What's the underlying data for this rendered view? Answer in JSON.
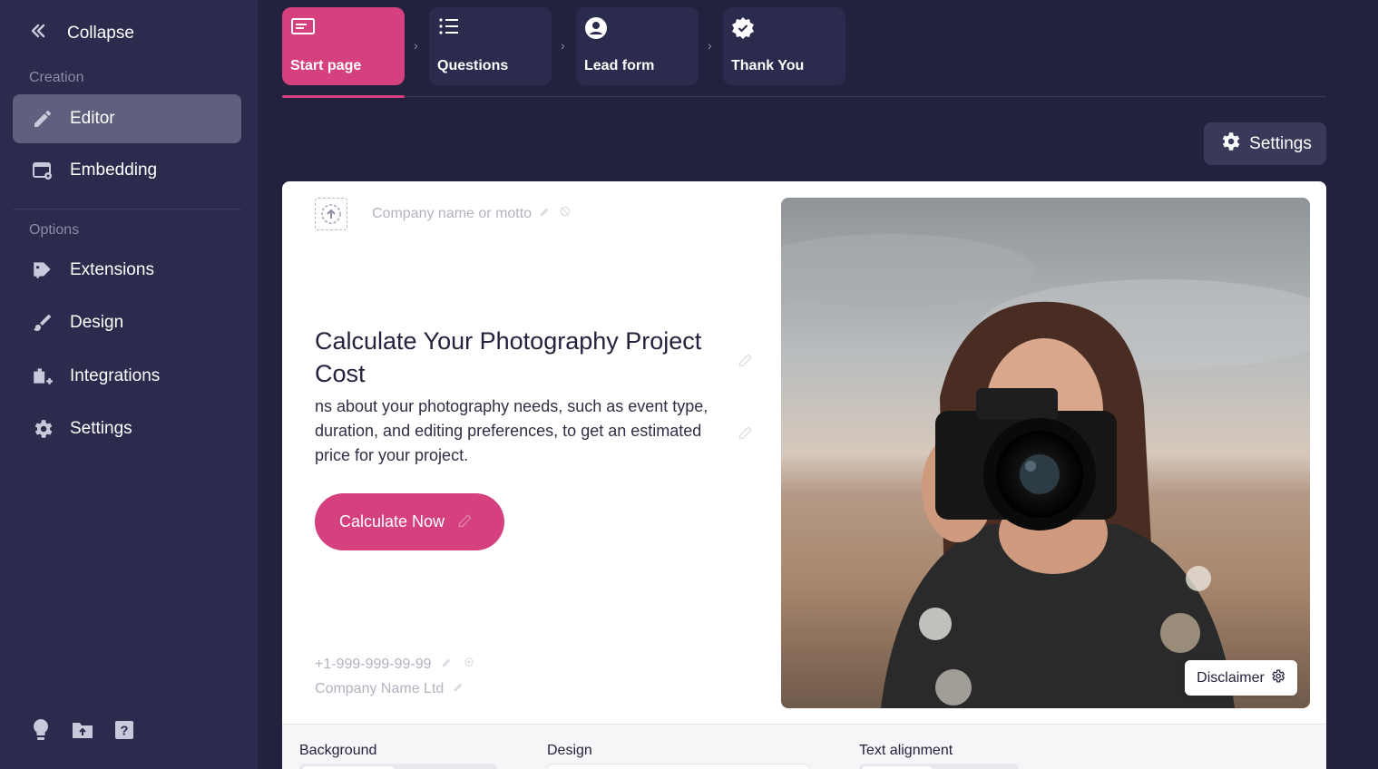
{
  "sidebar": {
    "collapse_label": "Collapse",
    "section_creation": "Creation",
    "section_options": "Options",
    "items": [
      {
        "label": "Editor",
        "icon": "pencil-icon",
        "active": true
      },
      {
        "label": "Embedding",
        "icon": "embed-icon"
      },
      {
        "label": "Extensions",
        "icon": "puzzle-icon"
      },
      {
        "label": "Design",
        "icon": "brush-icon"
      },
      {
        "label": "Integrations",
        "icon": "plug-icon"
      },
      {
        "label": "Settings",
        "icon": "gear-icon"
      }
    ],
    "footer_icons": [
      "lightbulb-icon",
      "folder-upload-icon",
      "help-icon"
    ]
  },
  "steps": [
    {
      "label": "Start page",
      "icon": "card-icon",
      "active": true
    },
    {
      "label": "Questions",
      "icon": "list-icon"
    },
    {
      "label": "Lead form",
      "icon": "user-circle-icon"
    },
    {
      "label": "Thank You",
      "icon": "verified-badge-icon"
    }
  ],
  "settings_button": "Settings",
  "card": {
    "motto_placeholder": "Company name or motto",
    "headline": "Calculate Your Photography Project Cost",
    "subtext": "ns about your photography needs, such as event type, duration, and editing preferences, to get an estimated price for your project.",
    "cta_label": "Calculate Now",
    "phone": "+1-999-999-99-99",
    "company_name": "Company Name Ltd",
    "disclaimer_label": "Disclaimer"
  },
  "bottom_panel": {
    "background_label": "Background",
    "design_label": "Design",
    "text_alignment_label": "Text alignment"
  },
  "colors": {
    "accent": "#d5417f",
    "sidebar_bg": "#2b2b4d",
    "page_bg": "#22223f"
  }
}
